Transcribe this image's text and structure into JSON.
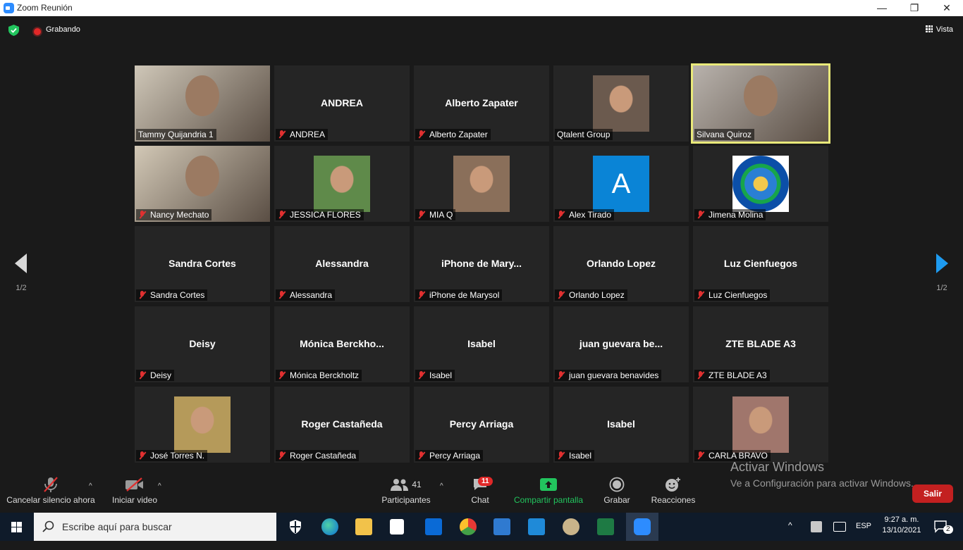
{
  "window": {
    "title": "Zoom Reunión",
    "minimize": "—",
    "maximize": "❐",
    "close": "✕"
  },
  "topbar": {
    "recording_label": "Grabando",
    "view_label": "Vista"
  },
  "nav": {
    "page_left": "1/2",
    "page_right": "1/2"
  },
  "tiles": [
    {
      "name": "Tammy Quijandria 1",
      "big": "",
      "muted": false,
      "kind": "video",
      "bg": "#cfc7b8"
    },
    {
      "name": "ANDREA",
      "big": "ANDREA",
      "muted": true,
      "kind": "name"
    },
    {
      "name": "Alberto Zapater",
      "big": "Alberto Zapater",
      "muted": true,
      "kind": "name"
    },
    {
      "name": "Qtalent Group",
      "big": "",
      "muted": false,
      "kind": "photo",
      "bg": "#6b5a4e"
    },
    {
      "name": "Silvana Quiroz",
      "big": "",
      "muted": false,
      "kind": "video",
      "bg": "#b8b2ac",
      "active": true
    },
    {
      "name": "Nancy  Mechato",
      "big": "",
      "muted": true,
      "kind": "video",
      "bg": "#d2c8b6"
    },
    {
      "name": "JESSICA FLORES",
      "big": "",
      "muted": true,
      "kind": "photo",
      "bg": "#5f8a4a"
    },
    {
      "name": "MIA Q",
      "big": "",
      "muted": true,
      "kind": "photo",
      "bg": "#8a6f5a"
    },
    {
      "name": "Alex Tirado",
      "big": "",
      "muted": true,
      "kind": "letter",
      "letter": "A",
      "bg": "#0a84d6"
    },
    {
      "name": "Jimena Molina",
      "big": "",
      "muted": true,
      "kind": "logo",
      "bg": "#ffffff"
    },
    {
      "name": "Sandra Cortes",
      "big": "Sandra Cortes",
      "muted": true,
      "kind": "name"
    },
    {
      "name": "Alessandra",
      "big": "Alessandra",
      "muted": true,
      "kind": "name"
    },
    {
      "name": "iPhone de Marysol",
      "big": "iPhone  de  Mary...",
      "muted": true,
      "kind": "name"
    },
    {
      "name": "Orlando Lopez",
      "big": "Orlando Lopez",
      "muted": true,
      "kind": "name"
    },
    {
      "name": "Luz Cienfuegos",
      "big": "Luz Cienfuegos",
      "muted": true,
      "kind": "name"
    },
    {
      "name": "Deisy",
      "big": "Deisy",
      "muted": true,
      "kind": "name"
    },
    {
      "name": "Mónica Berckholtz",
      "big": "Mónica  Berckho...",
      "muted": true,
      "kind": "name"
    },
    {
      "name": "Isabel",
      "big": "Isabel",
      "muted": true,
      "kind": "name"
    },
    {
      "name": "juan guevara benavides",
      "big": "juan  guevara  be...",
      "muted": true,
      "kind": "name"
    },
    {
      "name": "ZTE BLADE A3",
      "big": "ZTE BLADE A3",
      "muted": true,
      "kind": "name"
    },
    {
      "name": "José Torres N.",
      "big": "",
      "muted": true,
      "kind": "photo",
      "bg": "#b59a5a"
    },
    {
      "name": "Roger Castañeda",
      "big": "Roger Castañeda",
      "muted": true,
      "kind": "name"
    },
    {
      "name": "Percy Arriaga",
      "big": "Percy Arriaga",
      "muted": true,
      "kind": "name"
    },
    {
      "name": "Isabel",
      "big": "Isabel",
      "muted": true,
      "kind": "name"
    },
    {
      "name": "CARLA BRAVO",
      "big": "",
      "muted": true,
      "kind": "photo",
      "bg": "#a0766c"
    }
  ],
  "toolbar": {
    "mute_label": "Cancelar silencio ahora",
    "video_label": "Iniciar video",
    "participants_label": "Participantes",
    "participants_count": "41",
    "chat_label": "Chat",
    "chat_badge": "11",
    "share_label": "Compartir pantalla",
    "record_label": "Grabar",
    "reactions_label": "Reacciones",
    "leave_label": "Salir"
  },
  "watermark": {
    "line1": "Activar Windows",
    "line2": "Ve a Configuración para activar Windows."
  },
  "taskbar": {
    "search_placeholder": "Escribe aquí para buscar",
    "lang": "ESP",
    "time": "9:27 a. m.",
    "date": "13/10/2021",
    "notifications": "2"
  },
  "colors": {
    "accent_green": "#22c55e",
    "leave_red": "#c32020",
    "active_border": "#e9e97a"
  }
}
